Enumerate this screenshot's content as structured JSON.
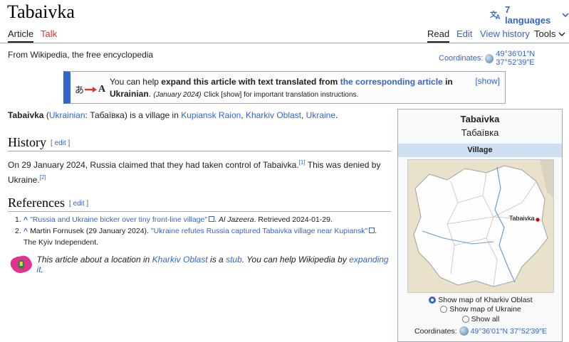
{
  "header": {
    "title": "Tabaivka",
    "languages_label": "7 languages"
  },
  "tabs": {
    "article": "Article",
    "talk": "Talk",
    "read": "Read",
    "edit": "Edit",
    "view_history": "View history",
    "tools": "Tools"
  },
  "subtitle": "From Wikipedia, the free encyclopedia",
  "coordinates": {
    "label": "Coordinates:",
    "value": "49°36′01″N 37°52′39″E"
  },
  "ambox": {
    "text_1": "You can help",
    "text_bold_1": "expand this article with text translated from",
    "link": "the corresponding article",
    "text_bold_2": "in Ukrainian",
    "text_2": ".",
    "date": "(January 2024)",
    "note": "Click [show] for important translation instructions.",
    "show": "[show]"
  },
  "lead": {
    "subject": "Tabaivka",
    "lang_link": "Ukrainian",
    "native": "Табаївка",
    "text_1": "is a village in",
    "raion": "Kupiansk Raion",
    "oblast": "Kharkiv Oblast",
    "country": "Ukraine"
  },
  "history": {
    "heading": "History",
    "edit": "edit",
    "text_1": "On 29 January 2024, Russia claimed that they had taken control of Tabaivka.",
    "ref_1": "[1]",
    "text_2": "This was denied by Ukraine.",
    "ref_2": "[2]"
  },
  "references": {
    "heading": "References",
    "edit": "edit",
    "items": [
      {
        "num": "1.",
        "caret": "^",
        "title": "\"Russia and Ukraine bicker over tiny front-line village\"",
        "source": "Al Jazeera",
        "retrieved": ". Retrieved 2024-01-29."
      },
      {
        "num": "2.",
        "caret": "^",
        "author": "Martin Fornusek (29 January 2024).",
        "title": "\"Ukraine refutes Russia captured Tabaivka village near Kupiansk\"",
        "source": "The Kyiv Independent."
      }
    ]
  },
  "stub": {
    "text_1": "This article about a location in",
    "oblast": "Kharkiv Oblast",
    "text_2": "is a",
    "stub_link": "stub",
    "text_3": ". You can help Wikipedia by",
    "expand_link": "expanding it",
    "text_4": "."
  },
  "infobox": {
    "title": "Tabaivka",
    "native": "Табаївка",
    "type": "Village",
    "map_label": "Tabaivka",
    "options": [
      "Show map of Kharkiv Oblast",
      "Show map of Ukraine",
      "Show all"
    ],
    "selected_index": 0,
    "coords_label": "Coordinates:",
    "coords_value": "49°36′01″N 37°52′39″E"
  },
  "colors": {
    "link": "#3366cc",
    "talk": "#d73333",
    "ambox_border": "#3366cc",
    "infobox_header": "#cee0f2"
  }
}
